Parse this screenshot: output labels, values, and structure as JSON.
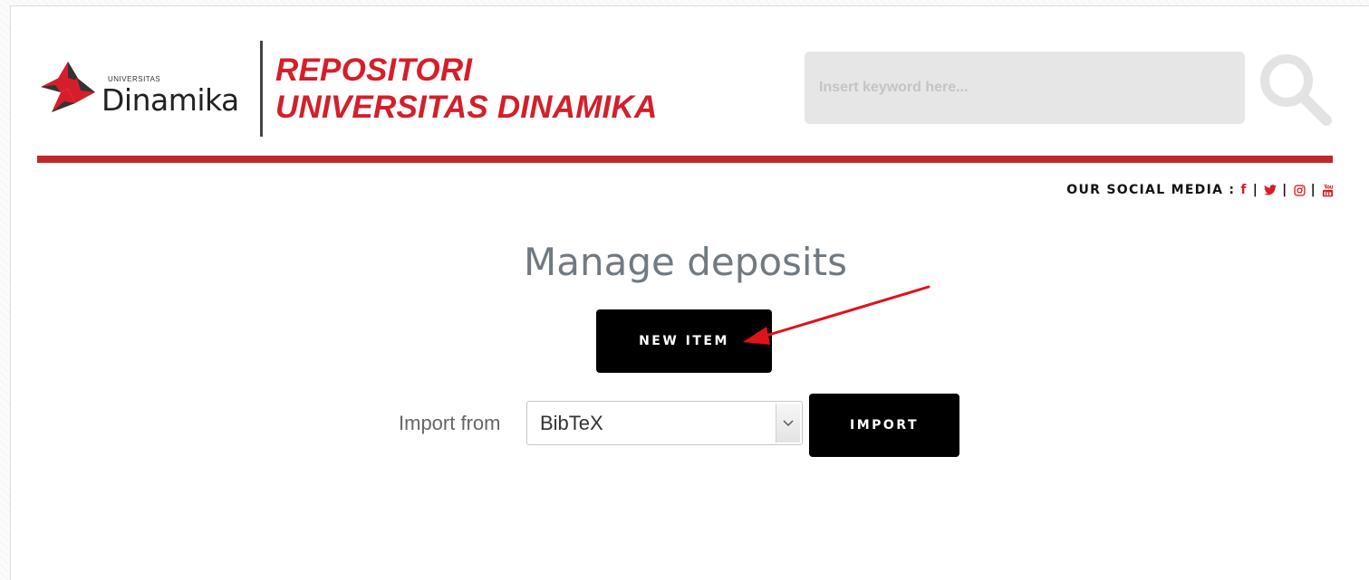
{
  "header": {
    "logo_small_text": "UNIVERSITAS",
    "logo_big_text": "Dinamika",
    "title_line1": "REPOSITORI",
    "title_line2": "UNIVERSITAS DINAMIKA",
    "search_placeholder": "Insert keyword here...",
    "search_icon": "search-icon",
    "brand_color": "#d41f2a"
  },
  "social": {
    "label": "OUR SOCIAL MEDIA :",
    "sep": "|",
    "icons": [
      "facebook-icon",
      "twitter-icon",
      "instagram-icon",
      "youtube-icon"
    ],
    "facebook_glyph": "f"
  },
  "main": {
    "heading": "Manage deposits",
    "new_item_label": "NEW ITEM",
    "import_label": "Import from",
    "import_selected": "BibTeX",
    "import_button_label": "IMPORT"
  },
  "annotation": {
    "arrow_color": "#e0121c"
  }
}
